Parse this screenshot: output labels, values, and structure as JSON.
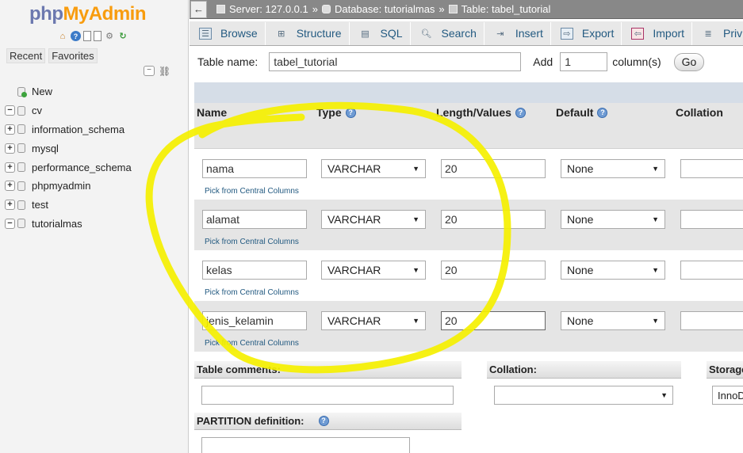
{
  "app": {
    "logo_part1": "php",
    "logo_part2": "MyAdmin"
  },
  "sidebar": {
    "quick_icons": [
      "home-icon",
      "help-icon",
      "docs-icon",
      "sql-docs-icon",
      "settings-icon",
      "reload-icon"
    ],
    "recent_label": "Recent",
    "favorites_label": "Favorites",
    "tree": [
      {
        "label": "New",
        "toggle": "",
        "icon": "new-db-icon"
      },
      {
        "label": "cv",
        "toggle": "−",
        "icon": "database-icon"
      },
      {
        "label": "information_schema",
        "toggle": "+",
        "icon": "database-icon"
      },
      {
        "label": "mysql",
        "toggle": "+",
        "icon": "database-icon"
      },
      {
        "label": "performance_schema",
        "toggle": "+",
        "icon": "database-icon"
      },
      {
        "label": "phpmyadmin",
        "toggle": "+",
        "icon": "database-icon"
      },
      {
        "label": "test",
        "toggle": "+",
        "icon": "database-icon"
      },
      {
        "label": "tutorialmas",
        "toggle": "−",
        "icon": "database-icon"
      }
    ]
  },
  "topbar": {
    "back": "←",
    "server": "Server: 127.0.0.1",
    "sep": "»",
    "database": "Database: tutorialmas",
    "table": "Table: tabel_tutorial"
  },
  "tabs": [
    {
      "label": "Browse",
      "icon": "browse-icon"
    },
    {
      "label": "Structure",
      "icon": "structure-icon"
    },
    {
      "label": "SQL",
      "icon": "sql-icon"
    },
    {
      "label": "Search",
      "icon": "search-icon"
    },
    {
      "label": "Insert",
      "icon": "insert-icon"
    },
    {
      "label": "Export",
      "icon": "export-icon"
    },
    {
      "label": "Import",
      "icon": "import-icon"
    },
    {
      "label": "Privi",
      "icon": "privileges-icon"
    }
  ],
  "table_form": {
    "table_name_label": "Table name:",
    "table_name_value": "tabel_tutorial",
    "add_label": "Add",
    "add_value": "1",
    "columns_label": "column(s)",
    "go_label": "Go"
  },
  "grid": {
    "headers": {
      "name": "Name",
      "type": "Type",
      "length": "Length/Values",
      "default": "Default",
      "collation": "Collation"
    },
    "pick_link": "Pick from Central Columns",
    "rows": [
      {
        "name": "nama",
        "type": "VARCHAR",
        "length": "20",
        "default": "None"
      },
      {
        "name": "alamat",
        "type": "VARCHAR",
        "length": "20",
        "default": "None"
      },
      {
        "name": "kelas",
        "type": "VARCHAR",
        "length": "20",
        "default": "None"
      },
      {
        "name": "jenis_kelamin",
        "type": "VARCHAR",
        "length": "20",
        "default": "None"
      }
    ]
  },
  "bottom": {
    "table_comments_label": "Table comments:",
    "collation_label": "Collation:",
    "storage_label": "Storage",
    "storage_value": "InnoD",
    "partition_label": "PARTITION definition:"
  },
  "colors": {
    "annotation": "#f5f000",
    "link": "#235a81",
    "logo_php": "#6c78af",
    "logo_myadmin": "#f89c0e"
  }
}
